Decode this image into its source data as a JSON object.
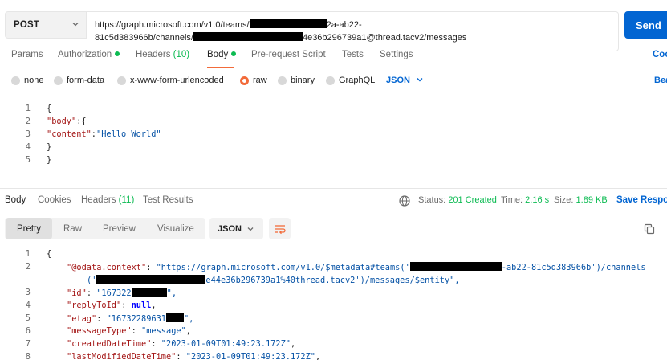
{
  "request": {
    "method": "POST",
    "url_line1_a": "https://graph.microsoft.com/v1.0/teams/",
    "url_line1_b": "2a-ab22-",
    "url_line2_a": "81c5d383966b/channels/",
    "url_line2_b": "4e36b296739a1@thread.tacv2/messages",
    "send_label": "Send",
    "code_link": "Coo"
  },
  "request_tabs": [
    {
      "label": "Params"
    },
    {
      "label": "Authorization"
    },
    {
      "label": "Headers",
      "count": "(10)"
    },
    {
      "label": "Body"
    },
    {
      "label": "Pre-request Script"
    },
    {
      "label": "Tests"
    },
    {
      "label": "Settings"
    }
  ],
  "body_types": [
    "none",
    "form-data",
    "x-www-form-urlencoded",
    "raw",
    "binary",
    "GraphQL"
  ],
  "body_format": "JSON",
  "beautify_link": "Bea",
  "request_body": {
    "line_numbers": [
      "1",
      "2",
      "3",
      "4",
      "5"
    ],
    "l1": "{",
    "l2_key": "\"body\"",
    "l2_rest": ":{",
    "l3_key": "\"content\"",
    "l3_colon": ":",
    "l3_val": "\"Hello World\"",
    "l4": "}",
    "l5": "}"
  },
  "response_tabs": [
    {
      "label": "Body"
    },
    {
      "label": "Cookies"
    },
    {
      "label": "Headers",
      "count": "(11)"
    },
    {
      "label": "Test Results"
    }
  ],
  "response_status": {
    "status_label": "Status:",
    "status_value": "201 Created",
    "time_label": "Time:",
    "time_value": "2.16 s",
    "size_label": "Size:",
    "size_value": "1.89 KB",
    "save_label": "Save Respo"
  },
  "view_modes": [
    "Pretty",
    "Raw",
    "Preview",
    "Visualize"
  ],
  "response_format": "JSON",
  "response_body": {
    "line_numbers": [
      "1",
      "2",
      "",
      "3",
      "4",
      "5",
      "6",
      "7",
      "8"
    ],
    "l1": "{",
    "l2_key": "\"@odata.context\"",
    "l2_val_a": "\"https://graph.microsoft.com/v1.0/$metadata#teams('",
    "l2_val_b": "-ab22-81c5d383966b')/channels",
    "l2w_a": "('",
    "l2w_b": "e44e36b296739a1%40thread.tacv2')/messages/$entity",
    "l2w_end": "\",",
    "l3_key": "\"id\"",
    "l3_val": "\"167322",
    "l4_key": "\"replyToId\"",
    "l4_val": "null",
    "l5_key": "\"etag\"",
    "l5_val": "\"16732289631",
    "l6_key": "\"messageType\"",
    "l6_val": "\"message\"",
    "l7_key": "\"createdDateTime\"",
    "l7_val": "\"2023-01-09T01:49:23.172Z\"",
    "l8_key": "\"lastModifiedDateTime\"",
    "l8_val": "\"2023-01-09T01:49:23.172Z\""
  },
  "colors": {
    "accent": "#f26b3a",
    "primary": "#0265d2",
    "success": "#0cbb52"
  }
}
